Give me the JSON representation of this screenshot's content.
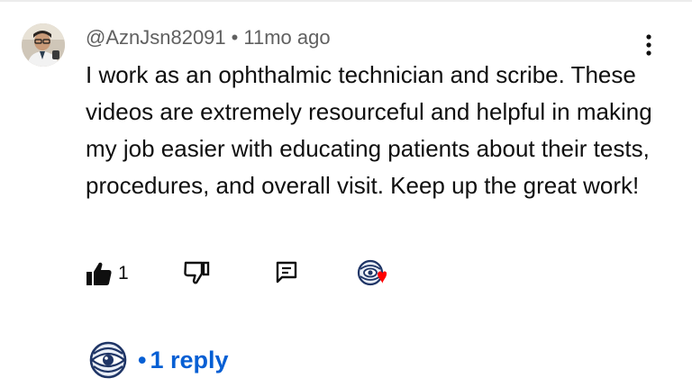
{
  "comment": {
    "author": "@AznJsn82091",
    "separator": "•",
    "time": "11mo ago",
    "text": "I work as an ophthalmic technician and scribe. These videos are extremely resourceful and helpful in making my job easier with educating patients about their tests, procedures, and overall visit. Keep up the great work!",
    "like_count": "1",
    "icons": {
      "avatar": "avatar-photo",
      "more": "more-vert-icon",
      "like": "thumb-up-filled-icon",
      "dislike": "thumb-down-outline-icon",
      "reply": "comment-reply-icon",
      "creator_heart": "creator-heart-icon"
    }
  },
  "replies": {
    "separator": "•",
    "label": "1 reply",
    "icon": "channel-avatar-icon"
  },
  "colors": {
    "link_blue": "#065fd4",
    "heart_red": "#ff0000",
    "meta_gray": "#606060",
    "text": "#0f0f0f"
  }
}
